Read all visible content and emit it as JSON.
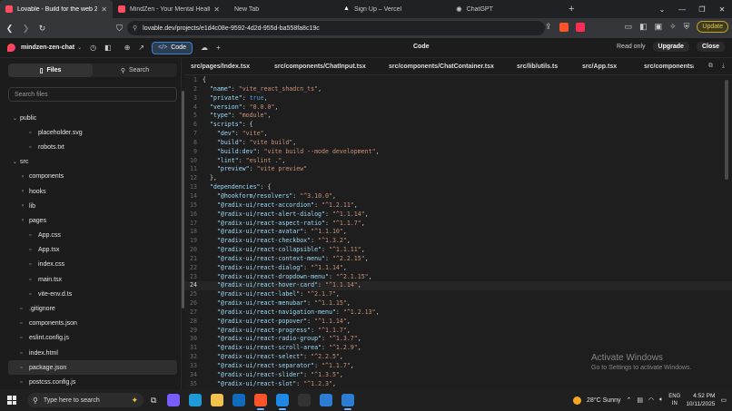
{
  "browser": {
    "tabs": [
      {
        "title": "Lovable - Build for the web 20x",
        "active": true,
        "color": "#ff4f5e"
      },
      {
        "title": "MindZen - Your Mental Health Comp",
        "active": false,
        "color": "#ff4f5e"
      },
      {
        "title": "New Tab",
        "active": false,
        "color": ""
      },
      {
        "title": "Sign Up – Vercel",
        "active": false,
        "color": "#ffffff"
      },
      {
        "title": "ChatGPT",
        "active": false,
        "color": "#cccccc"
      }
    ],
    "url": "lovable.dev/projects/e1d4c08e-9592-4d2d-955d-ba558fa8c19c",
    "update_label": "Update"
  },
  "app": {
    "project_name": "mindzen-zen-chat",
    "code_button": "Code",
    "center_title": "Code",
    "read_only": "Read only",
    "upgrade": "Upgrade",
    "close": "Close"
  },
  "sidebar": {
    "files_tab": "Files",
    "search_tab": "Search",
    "search_placeholder": "Search files",
    "tree": [
      {
        "name": "public",
        "type": "folder-open",
        "indent": 0
      },
      {
        "name": "placeholder.svg",
        "type": "file",
        "indent": 1
      },
      {
        "name": "robots.txt",
        "type": "file",
        "indent": 1
      },
      {
        "name": "src",
        "type": "folder-open",
        "indent": 0
      },
      {
        "name": "components",
        "type": "folder",
        "indent": 1
      },
      {
        "name": "hooks",
        "type": "folder",
        "indent": 1
      },
      {
        "name": "lib",
        "type": "folder",
        "indent": 1
      },
      {
        "name": "pages",
        "type": "folder",
        "indent": 1
      },
      {
        "name": "App.css",
        "type": "file",
        "indent": 1
      },
      {
        "name": "App.tsx",
        "type": "file",
        "indent": 1
      },
      {
        "name": "index.css",
        "type": "file",
        "indent": 1
      },
      {
        "name": "main.tsx",
        "type": "file",
        "indent": 1
      },
      {
        "name": "vite-env.d.ts",
        "type": "file",
        "indent": 1
      },
      {
        "name": ".gitignore",
        "type": "file",
        "indent": 0
      },
      {
        "name": "components.json",
        "type": "file",
        "indent": 0
      },
      {
        "name": "eslint.config.js",
        "type": "file",
        "indent": 0
      },
      {
        "name": "index.html",
        "type": "file",
        "indent": 0
      },
      {
        "name": "package.json",
        "type": "file",
        "indent": 0,
        "selected": true
      },
      {
        "name": "postcss.config.js",
        "type": "file",
        "indent": 0
      }
    ]
  },
  "editor": {
    "tabs": [
      "src/pages/Index.tsx",
      "src/components/ChatInput.tsx",
      "src/components/ChatContainer.tsx",
      "src/lib/utils.ts",
      "src/App.tsx",
      "src/components/"
    ],
    "current_line": 24,
    "lines": [
      "{",
      "  \"name\": \"vite_react_shadcn_ts\",",
      "  \"private\": true,",
      "  \"version\": \"0.0.0\",",
      "  \"type\": \"module\",",
      "  \"scripts\": {",
      "    \"dev\": \"vite\",",
      "    \"build\": \"vite build\",",
      "    \"build:dev\": \"vite build --mode development\",",
      "    \"lint\": \"eslint .\",",
      "    \"preview\": \"vite preview\"",
      "  },",
      "  \"dependencies\": {",
      "    \"@hookform/resolvers\": \"^3.10.0\",",
      "    \"@radix-ui/react-accordion\": \"^1.2.11\",",
      "    \"@radix-ui/react-alert-dialog\": \"^1.1.14\",",
      "    \"@radix-ui/react-aspect-ratio\": \"^1.1.7\",",
      "    \"@radix-ui/react-avatar\": \"^1.1.10\",",
      "    \"@radix-ui/react-checkbox\": \"^1.3.2\",",
      "    \"@radix-ui/react-collapsible\": \"^1.1.11\",",
      "    \"@radix-ui/react-context-menu\": \"^2.2.15\",",
      "    \"@radix-ui/react-dialog\": \"^1.1.14\",",
      "    \"@radix-ui/react-dropdown-menu\": \"^2.1.15\",",
      "    \"@radix-ui/react-hover-card\": \"^1.1.14\",",
      "    \"@radix-ui/react-label\": \"^2.1.7\",",
      "    \"@radix-ui/react-menubar\": \"^1.1.15\",",
      "    \"@radix-ui/react-navigation-menu\": \"^1.2.13\",",
      "    \"@radix-ui/react-popover\": \"^1.1.14\",",
      "    \"@radix-ui/react-progress\": \"^1.1.7\",",
      "    \"@radix-ui/react-radio-group\": \"^1.3.7\",",
      "    \"@radix-ui/react-scroll-area\": \"^1.2.9\",",
      "    \"@radix-ui/react-select\": \"^2.2.5\",",
      "    \"@radix-ui/react-separator\": \"^1.1.7\",",
      "    \"@radix-ui/react-slider\": \"^1.3.5\",",
      "    \"@radix-ui/react-slot\": \"^1.2.3\","
    ]
  },
  "watermark": {
    "title": "Activate Windows",
    "subtitle": "Go to Settings to activate Windows."
  },
  "taskbar": {
    "search_placeholder": "Type here to search",
    "weather": "28°C  Sunny",
    "lang_top": "ENG",
    "lang_bottom": "IN",
    "time": "4:52 PM",
    "date": "10/11/2025",
    "apps": [
      {
        "name": "copilot",
        "color": "#7b5cff"
      },
      {
        "name": "edge",
        "color": "#1f9ad6"
      },
      {
        "name": "explorer",
        "color": "#f2c14e"
      },
      {
        "name": "outlook",
        "color": "#0f6cbd"
      },
      {
        "name": "brave",
        "color": "#fb542b",
        "active": true
      },
      {
        "name": "vscode",
        "color": "#1e88e5",
        "active": true
      },
      {
        "name": "terminal",
        "color": "#333333"
      },
      {
        "name": "app-blue",
        "color": "#2d7dd2"
      },
      {
        "name": "vscode-2",
        "color": "#2d7dd2",
        "active": true
      }
    ]
  }
}
